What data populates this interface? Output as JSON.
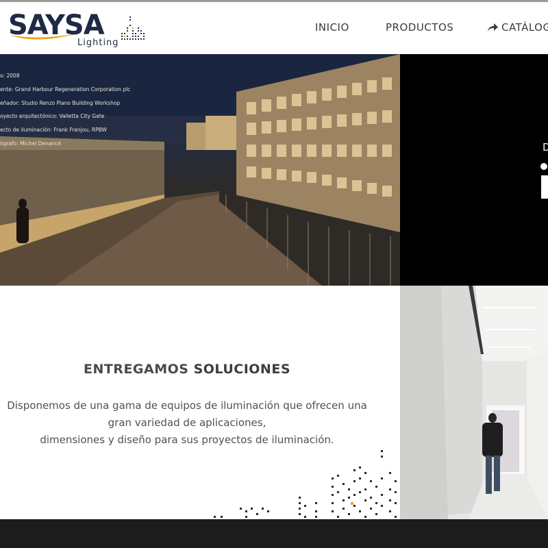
{
  "header": {
    "logo": {
      "word": "SAYSA",
      "sub": "Lighting",
      "brand_color": "#1f2a44",
      "swoosh_color": "#f0a21a"
    },
    "nav": {
      "inicio": "INICIO",
      "productos": "PRODUCTOS",
      "catalogo": "CATÁLOG",
      "catalogo_icon": "share-arrow-icon"
    }
  },
  "hero": {
    "credits": [
      "o: 2008",
      "ente: Grand Harbour Regeneration Corporation plc",
      "eñador: Studio Renzo Piano Building Workshop",
      "oyecto arquitectónico: Valletta City Gate",
      "ecto de iluminación: Frank Franjou, RPBW",
      "ógrafo: Michel Denancé"
    ]
  },
  "side_panel": {
    "letter": "D",
    "background": "#000000"
  },
  "solutions": {
    "title_light": "ENTREGAMOS ",
    "title_bold": "SOLUCIONES",
    "text_line1": "Disponemos de una gama de equipos de iluminación que ofrecen una",
    "text_line2": "gran variedad de aplicaciones,",
    "text_line3": "dimensiones y diseño para sus proyectos de iluminación."
  },
  "colors": {
    "accent": "#f0a21a",
    "footer": "#1c1c1c",
    "text": "#505050"
  }
}
